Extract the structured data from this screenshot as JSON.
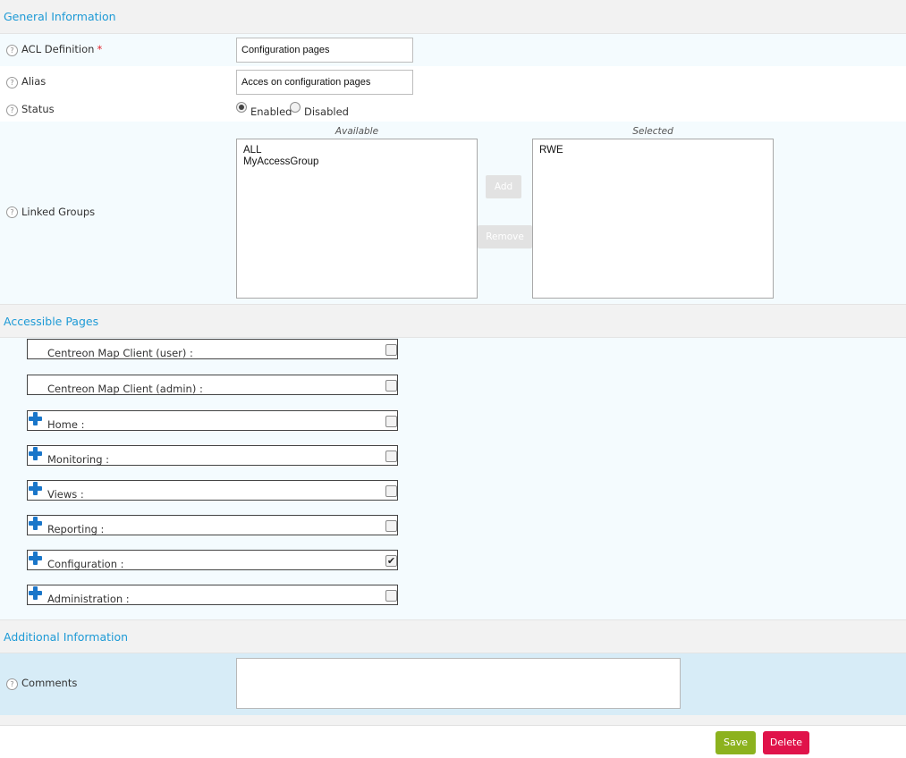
{
  "sections": {
    "general": "General Information",
    "accessible": "Accessible Pages",
    "additional": "Additional Information"
  },
  "help_glyph": "?",
  "fields": {
    "acl_definition": {
      "label": "ACL Definition",
      "required_mark": "*",
      "value": "Configuration pages"
    },
    "alias": {
      "label": "Alias",
      "value": "Acces on configuration pages"
    },
    "status": {
      "label": "Status",
      "options": [
        "Enabled",
        "Disabled"
      ],
      "selected": "Enabled"
    },
    "linked_groups": {
      "label": "Linked Groups",
      "available_title": "Available",
      "selected_title": "Selected",
      "available": [
        "ALL",
        "MyAccessGroup"
      ],
      "selected": [
        "RWE"
      ],
      "add_label": "Add",
      "remove_label": "Remove"
    },
    "comments": {
      "label": "Comments",
      "value": ""
    }
  },
  "pages": [
    {
      "name": "Centreon Map Client (user) :",
      "expandable": false,
      "checked": false
    },
    {
      "name": "Centreon Map Client (admin) :",
      "expandable": false,
      "checked": false
    },
    {
      "name": "Home :",
      "expandable": true,
      "checked": false
    },
    {
      "name": "Monitoring :",
      "expandable": true,
      "checked": false
    },
    {
      "name": "Views :",
      "expandable": true,
      "checked": false
    },
    {
      "name": "Reporting :",
      "expandable": true,
      "checked": false
    },
    {
      "name": "Configuration :",
      "expandable": true,
      "checked": true
    },
    {
      "name": "Administration :",
      "expandable": true,
      "checked": false
    }
  ],
  "buttons": {
    "save": "Save",
    "delete": "Delete"
  },
  "colors": {
    "accent": "#1d9ad6",
    "save": "#8cb21e",
    "delete": "#e0134a",
    "expand_icon": "#1a76c9"
  }
}
